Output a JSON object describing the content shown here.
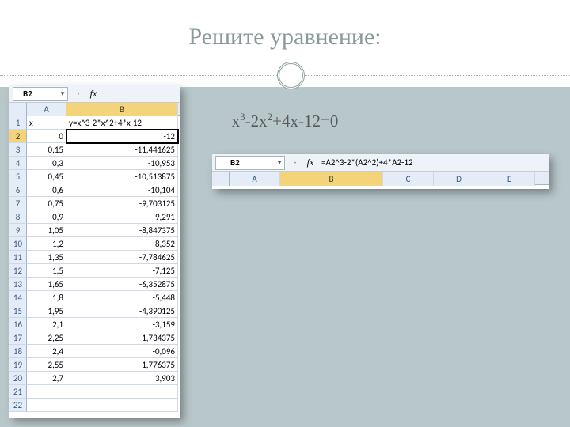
{
  "title": "Решите уравнение:",
  "equation": {
    "base": "x",
    "e1": "3",
    "mid1": "-2x",
    "e2": "2",
    "rest": "+4x-12=0"
  },
  "left": {
    "cellref": "B2",
    "fx_label": "fx",
    "cols": [
      "A",
      "B"
    ],
    "sel_col": "B",
    "sel_row": 2,
    "header_row": {
      "A": "x",
      "B": "y=x^3-2*x^2+4*x-12"
    },
    "rows": [
      {
        "n": 1,
        "A": "x",
        "B": "y=x^3-2*x^2+4*x-12",
        "leftA": true,
        "leftB": true
      },
      {
        "n": 2,
        "A": "0",
        "B": "-12"
      },
      {
        "n": 3,
        "A": "0,15",
        "B": "-11,441625"
      },
      {
        "n": 4,
        "A": "0,3",
        "B": "-10,953"
      },
      {
        "n": 5,
        "A": "0,45",
        "B": "-10,513875"
      },
      {
        "n": 6,
        "A": "0,6",
        "B": "-10,104"
      },
      {
        "n": 7,
        "A": "0,75",
        "B": "-9,703125"
      },
      {
        "n": 8,
        "A": "0,9",
        "B": "-9,291"
      },
      {
        "n": 9,
        "A": "1,05",
        "B": "-8,847375"
      },
      {
        "n": 10,
        "A": "1,2",
        "B": "-8,352"
      },
      {
        "n": 11,
        "A": "1,35",
        "B": "-7,784625"
      },
      {
        "n": 12,
        "A": "1,5",
        "B": "-7,125"
      },
      {
        "n": 13,
        "A": "1,65",
        "B": "-6,352875"
      },
      {
        "n": 14,
        "A": "1,8",
        "B": "-5,448"
      },
      {
        "n": 15,
        "A": "1,95",
        "B": "-4,390125"
      },
      {
        "n": 16,
        "A": "2,1",
        "B": "-3,159"
      },
      {
        "n": 17,
        "A": "2,25",
        "B": "-1,734375"
      },
      {
        "n": 18,
        "A": "2,4",
        "B": "-0,096"
      },
      {
        "n": 19,
        "A": "2,55",
        "B": "1,776375"
      },
      {
        "n": 20,
        "A": "2,7",
        "B": "3,903"
      },
      {
        "n": 21,
        "A": "",
        "B": ""
      },
      {
        "n": 22,
        "A": "",
        "B": ""
      }
    ]
  },
  "right": {
    "cellref": "B2",
    "fx_label": "fx",
    "formula": "=A2^3-2*(A2^2)+4*A2-12",
    "cols": [
      "A",
      "B",
      "C",
      "D",
      "E"
    ],
    "sel_col": "B"
  }
}
